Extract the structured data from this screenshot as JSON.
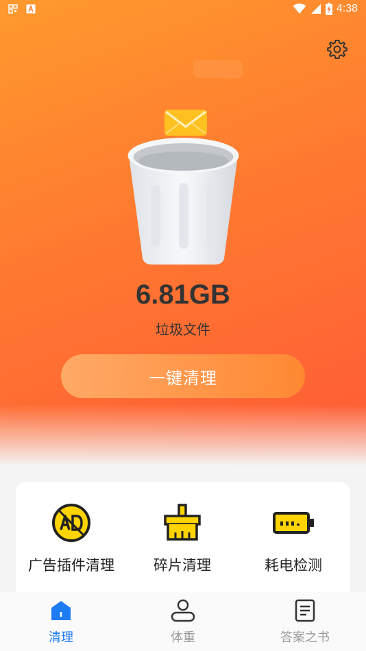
{
  "status_bar": {
    "time": "4:38",
    "left_icons": [
      "qr-notify-icon",
      "a-notify-icon"
    ],
    "right_icons": [
      "wifi-icon",
      "cellular-icon",
      "battery-charging-icon"
    ]
  },
  "header": {
    "settings_icon": "gear-icon"
  },
  "hero": {
    "junk_size": "6.81GB",
    "junk_label": "垃圾文件",
    "clean_button": "一键清理"
  },
  "tools": [
    {
      "label": "广告插件清理",
      "icon": "ad-icon"
    },
    {
      "label": "碎片清理",
      "icon": "brush-icon"
    },
    {
      "label": "耗电检测",
      "icon": "battery-icon"
    }
  ],
  "bottom_nav": [
    {
      "label": "清理",
      "icon": "home-icon",
      "active": true
    },
    {
      "label": "体重",
      "icon": "person-icon",
      "active": false
    },
    {
      "label": "答案之书",
      "icon": "book-icon",
      "active": false
    }
  ],
  "colors": {
    "hero_start": "#ff9a2e",
    "hero_end": "#ff5a36",
    "nav_active": "#1e7cf2",
    "nav_inactive": "#9a9a9a",
    "icon_yellow": "#ffd400"
  }
}
